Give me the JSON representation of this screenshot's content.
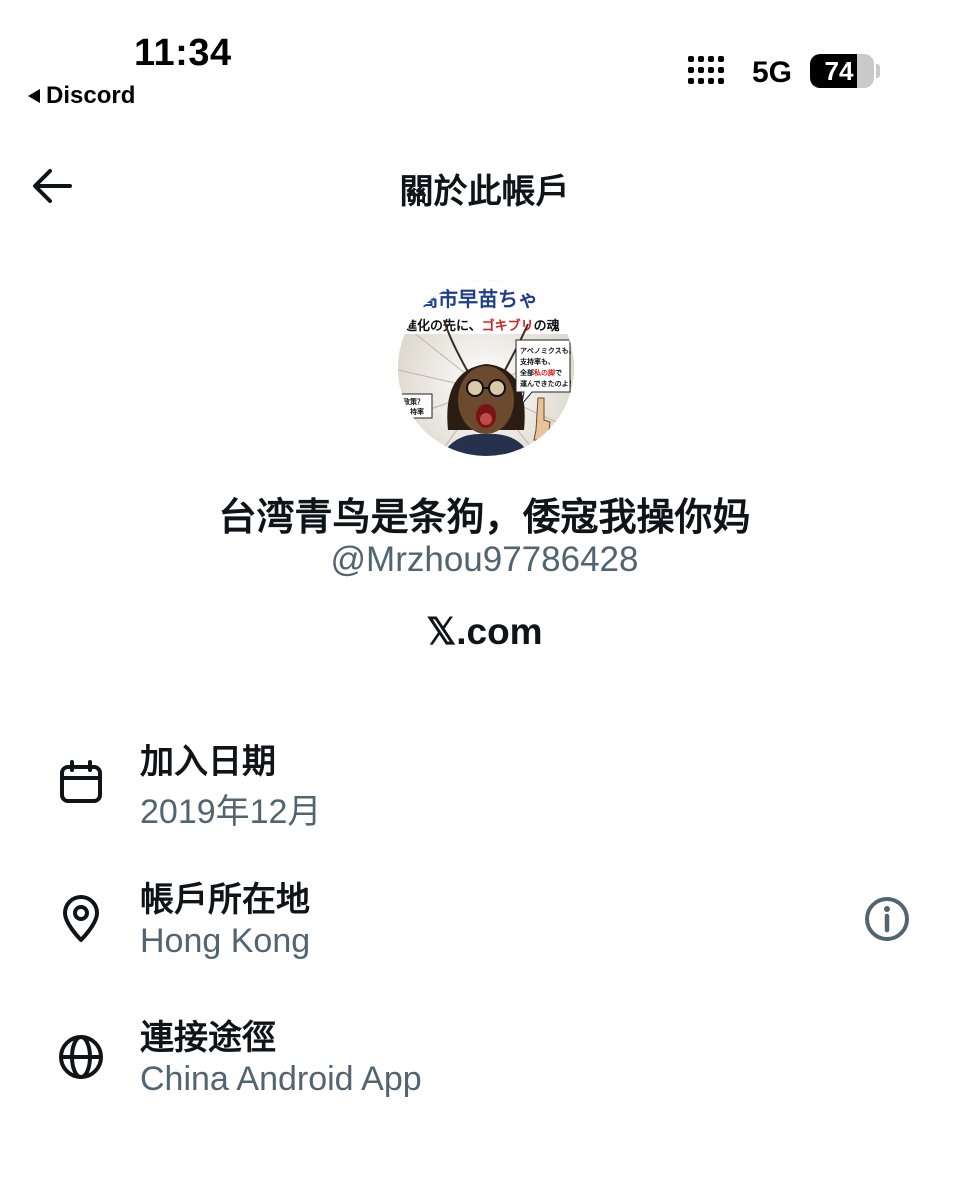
{
  "status_bar": {
    "time": "11:34",
    "back_app": "Discord",
    "network": "5G",
    "battery_percent": "74",
    "battery_level": 0.74
  },
  "header": {
    "title": "關於此帳戶",
    "back_icon": "arrow-left-icon"
  },
  "profile": {
    "display_name": "台湾青鸟是条狗，倭寇我操你妈",
    "handle": "@Mrzhou97786428",
    "source": "𝕏.com",
    "avatar_text": {
      "top": "高市早苗ちゃ",
      "middle_prefix": "進化の先に、",
      "middle_highlight": "ゴキブリ",
      "middle_suffix": "の魂",
      "right_line1": "アベノミクスも、",
      "right_line2": "支持率も、",
      "right_line3_prefix": "全部",
      "right_line3_highlight": "私の脚",
      "right_line3_suffix": "で",
      "right_line4": "運んできたのよ！",
      "left_line1": "政策？",
      "left_line2": "よ",
      "left_line3": "持率"
    }
  },
  "rows": [
    {
      "icon": "calendar-icon",
      "label": "加入日期",
      "value": "2019年12月"
    },
    {
      "icon": "location-pin-icon",
      "label": "帳戶所在地",
      "value": "Hong Kong",
      "trailing_icon": "info-icon"
    },
    {
      "icon": "globe-icon",
      "label": "連接途徑",
      "value": "China Android App"
    }
  ],
  "colors": {
    "text_primary": "#0f1419",
    "text_secondary": "#536471",
    "background": "#ffffff",
    "avatar_highlight": "#d61f1f"
  }
}
